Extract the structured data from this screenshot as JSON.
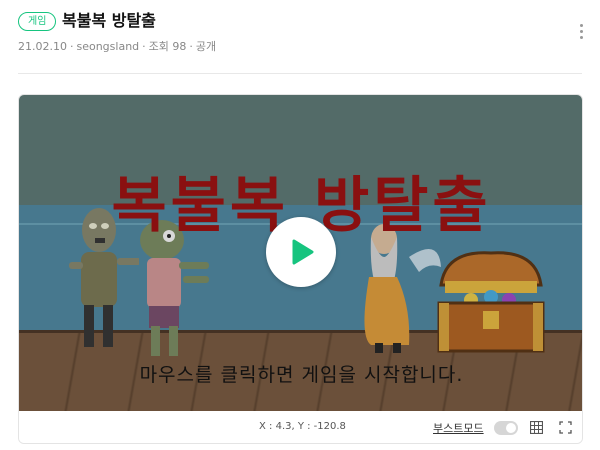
{
  "post": {
    "tag": "게임",
    "title": "복불복 방탈출",
    "date": "21.02.10",
    "author": "seongsland",
    "views": "조회 98",
    "visibility": "공개",
    "more_icon": "more-vertical-icon"
  },
  "game": {
    "title": "복불복 방탈출",
    "message": "마우스를 클릭하면 게임을 시작합니다.",
    "play_icon": "play-icon"
  },
  "controls": {
    "coords": "X : 4.3, Y : -120.8",
    "boost_label": "부스트모드",
    "boost_on": false,
    "grid_icon": "grid-icon",
    "fullscreen_icon": "fullscreen-icon"
  },
  "colors": {
    "accent": "#16c47f",
    "title_red": "#8a1010"
  }
}
